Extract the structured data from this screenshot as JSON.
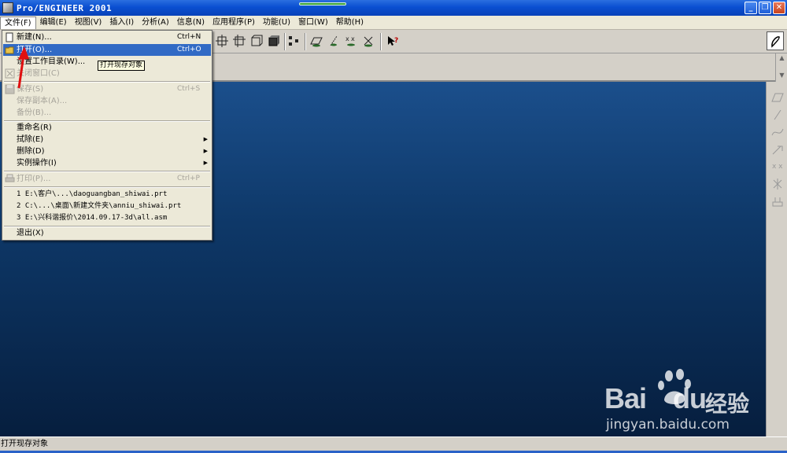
{
  "window": {
    "title": "Pro/ENGINEER 2001"
  },
  "menubar": [
    {
      "label": "文件(F)"
    },
    {
      "label": "编辑(E)"
    },
    {
      "label": "视图(V)"
    },
    {
      "label": "插入(I)"
    },
    {
      "label": "分析(A)"
    },
    {
      "label": "信息(N)"
    },
    {
      "label": "应用程序(P)"
    },
    {
      "label": "功能(U)"
    },
    {
      "label": "窗口(W)"
    },
    {
      "label": "帮助(H)"
    }
  ],
  "file_menu": {
    "items": [
      {
        "label": "新建(N)...",
        "shortcut": "Ctrl+N",
        "enabled": true
      },
      {
        "label": "打开(O)...",
        "shortcut": "Ctrl+O",
        "enabled": true,
        "selected": true
      },
      {
        "label": "设置工作目录(W)...",
        "shortcut": "",
        "enabled": true
      },
      {
        "label": "关闭窗口(C)",
        "shortcut": "",
        "enabled": false
      },
      {
        "label": "保存(S)",
        "shortcut": "Ctrl+S",
        "enabled": false
      },
      {
        "label": "保存副本(A)...",
        "shortcut": "",
        "enabled": false
      },
      {
        "label": "备份(B)...",
        "shortcut": "",
        "enabled": false
      },
      {
        "label": "重命名(R)",
        "shortcut": "",
        "enabled": true
      },
      {
        "label": "拭除(E)",
        "shortcut": "",
        "enabled": true,
        "submenu": true
      },
      {
        "label": "删除(D)",
        "shortcut": "",
        "enabled": true,
        "submenu": true
      },
      {
        "label": "实例操作(I)",
        "shortcut": "",
        "enabled": true,
        "submenu": true
      },
      {
        "label": "打印(P)...",
        "shortcut": "Ctrl+P",
        "enabled": false
      },
      {
        "label": "1 E:\\客户\\...\\daoguangban_shiwai.prt",
        "shortcut": "",
        "enabled": true
      },
      {
        "label": "2 C:\\...\\桌面\\新建文件夹\\anniu_shiwai.prt",
        "shortcut": "",
        "enabled": true
      },
      {
        "label": "3 E:\\兴科谐报价\\2014.09.17-3d\\all.asm",
        "shortcut": "",
        "enabled": true
      },
      {
        "label": "退出(X)",
        "shortcut": "",
        "enabled": true
      }
    ]
  },
  "tooltip": {
    "text": "打开现存对象"
  },
  "statusbar": {
    "text": "打开现存对象"
  },
  "watermark": {
    "brand": "Bai",
    "brand2": "du",
    "cn": "经验",
    "url": "jingyan.baidu.com"
  },
  "colors": {
    "selection": "#316ac5",
    "viewport_top": "#1b4f8c",
    "viewport_bottom": "#061e3e",
    "menu_bg": "#ece9d8"
  }
}
